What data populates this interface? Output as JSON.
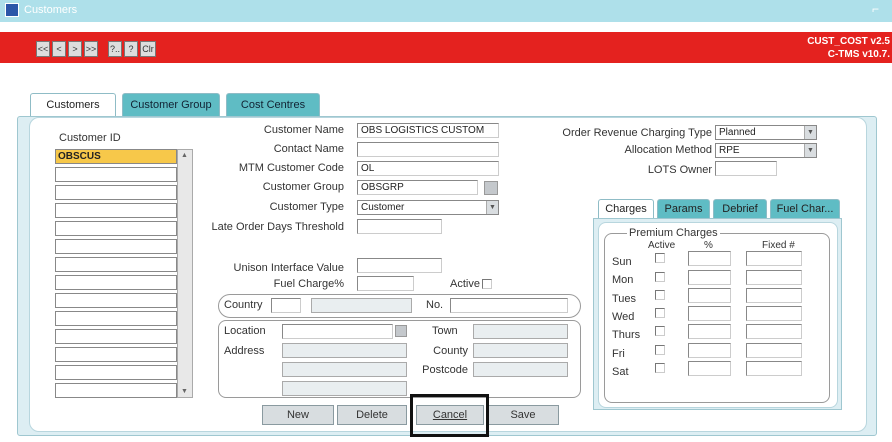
{
  "window": {
    "title": "Customers",
    "version_line1": "CUST_COST v2.5",
    "version_line2": "C-TMS v10.7."
  },
  "toolbar": {
    "buttons": [
      "<<",
      "<",
      ">",
      ">>",
      "?..",
      "?",
      "Clr"
    ]
  },
  "tabs": {
    "customers": "Customers",
    "customer_group": "Customer Group",
    "cost_centres": "Cost Centres"
  },
  "customer_list": {
    "header": "Customer ID",
    "selected": "OBSCUS"
  },
  "form": {
    "customer_name_label": "Customer Name",
    "customer_name": "OBS LOGISTICS CUSTOM",
    "contact_name_label": "Contact Name",
    "contact_name": "",
    "mtm_code_label": "MTM Customer Code",
    "mtm_code": "OL",
    "customer_group_label": "Customer Group",
    "customer_group": "OBSGRP",
    "customer_type_label": "Customer Type",
    "customer_type": "Customer",
    "late_order_label": "Late Order Days Threshold",
    "unison_label": "Unison Interface Value",
    "fuel_charge_label": "Fuel Charge%",
    "active_label": "Active",
    "country_label": "Country",
    "no_label": "No.",
    "location_label": "Location",
    "town_label": "Town",
    "address_label": "Address",
    "county_label": "County",
    "postcode_label": "Postcode"
  },
  "right": {
    "order_revenue_label": "Order Revenue Charging Type",
    "order_revenue": "Planned",
    "allocation_label": "Allocation Method",
    "allocation": "RPE",
    "lots_owner_label": "LOTS Owner"
  },
  "subtabs": {
    "charges": "Charges",
    "params": "Params",
    "debrief": "Debrief",
    "fuel": "Fuel Char..."
  },
  "premium": {
    "title": "Premium Charges",
    "col_active": "Active",
    "col_pct": "%",
    "col_fixed": "Fixed #",
    "days": [
      "Sun",
      "Mon",
      "Tues",
      "Wed",
      "Thurs",
      "Fri",
      "Sat"
    ]
  },
  "buttons": {
    "new": "New",
    "delete": "Delete",
    "cancel": "Cancel",
    "save": "Save"
  }
}
